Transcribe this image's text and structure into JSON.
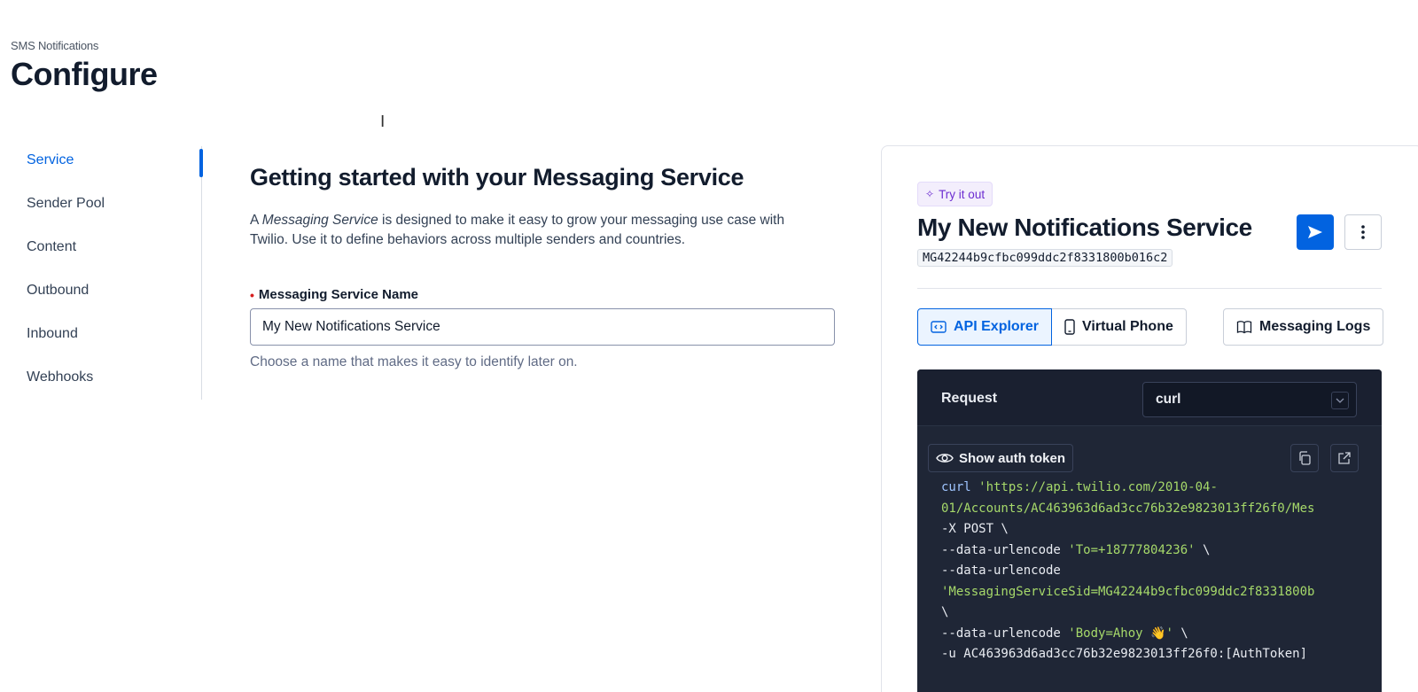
{
  "header": {
    "breadcrumb": "SMS Notifications",
    "title": "Configure"
  },
  "sidebar": {
    "items": [
      {
        "label": "Service",
        "active": true
      },
      {
        "label": "Sender Pool",
        "active": false
      },
      {
        "label": "Content",
        "active": false
      },
      {
        "label": "Outbound",
        "active": false
      },
      {
        "label": "Inbound",
        "active": false
      },
      {
        "label": "Webhooks",
        "active": false
      }
    ]
  },
  "main": {
    "heading": "Getting started with your Messaging Service",
    "desc_prefix": "A ",
    "desc_emphasis": "Messaging Service",
    "desc_line1_rest": " is designed to make it easy to grow your messaging use case with",
    "desc_line2": "Twilio. Use it to define behaviors across multiple senders and countries.",
    "field_label": "Messaging Service Name",
    "field_value": "My New Notifications Service",
    "field_help": "Choose a name that makes it easy to identify later on."
  },
  "panel": {
    "badge": "Try it out",
    "title": "My New Notifications Service",
    "sid": "MG42244b9cfbc099ddc2f8331800b016c2",
    "tabs": [
      {
        "label": "API Explorer",
        "icon": "code-icon",
        "active": true
      },
      {
        "label": "Virtual Phone",
        "icon": "phone-icon",
        "active": false
      }
    ],
    "logs_label": "Messaging Logs",
    "request_label": "Request",
    "language": "curl",
    "auth_label": "Show auth token",
    "code": {
      "l1_cmd": "curl",
      "l1_str": " 'https://api.twilio.com/2010-04-",
      "l2": "01/Accounts/AC463963d6ad3cc76b32e9823013ff26f0/Mes",
      "l3": "-X POST \\",
      "l4_flag": "--data-urlencode ",
      "l4_str": "'To=+18777804236'",
      "l4_tail": " \\",
      "l5": "--data-urlencode",
      "l6": "'MessagingServiceSid=MG42244b9cfbc099ddc2f8331800b",
      "l7": "\\",
      "l8_flag": "--data-urlencode ",
      "l8_str": "'Body=Ahoy 👋'",
      "l8_tail": " \\",
      "l9": "-u AC463963d6ad3cc76b32e9823013ff26f0:[AuthToken]"
    }
  },
  "colors": {
    "accent": "#0263e0",
    "code_bg": "#1f2636",
    "code_string": "#a6d96a"
  }
}
